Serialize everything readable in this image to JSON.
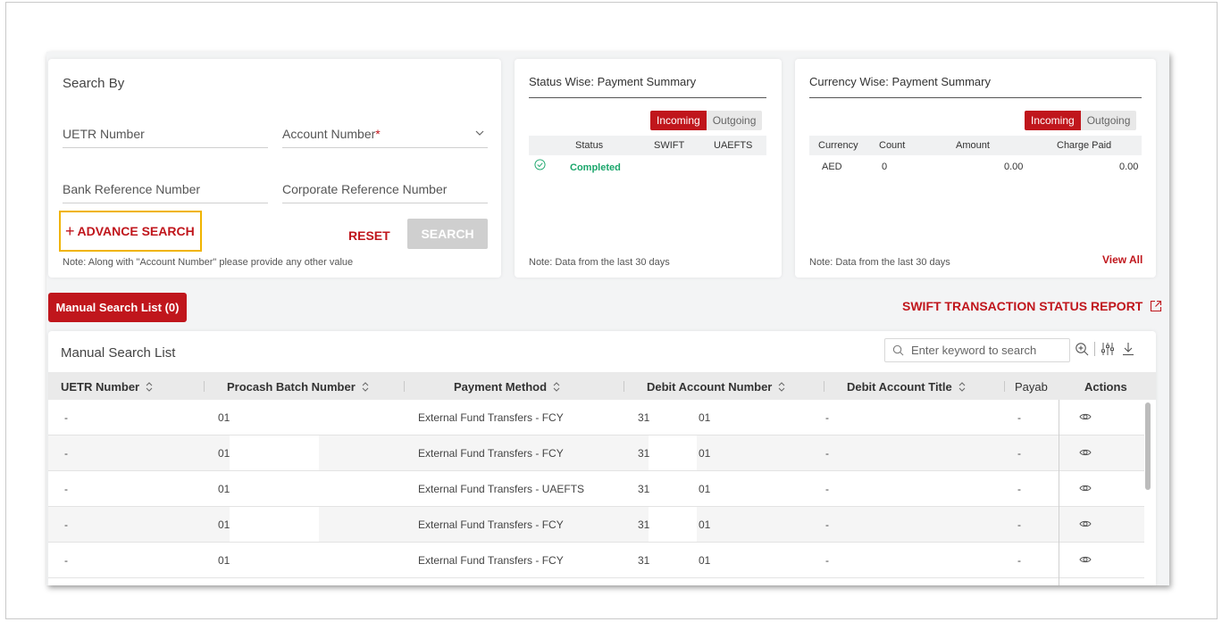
{
  "search": {
    "title": "Search By",
    "uetr_label": "UETR Number",
    "account_label": "Account Number",
    "account_required": "*",
    "bank_ref_label": "Bank Reference Number",
    "corp_ref_label": "Corporate Reference Number",
    "advance_plus": "+",
    "advance_label": "ADVANCE SEARCH",
    "reset_label": "RESET",
    "search_label": "SEARCH",
    "note": "Note: Along with \"Account Number\" please provide any other value"
  },
  "status_summary": {
    "title": "Status Wise: Payment Summary",
    "toggle_on": "Incoming",
    "toggle_off": "Outgoing",
    "headers": [
      "Status",
      "SWIFT",
      "UAEFTS"
    ],
    "row_status": "Completed",
    "note": "Note: Data from the last 30 days"
  },
  "currency_summary": {
    "title": "Currency Wise: Payment Summary",
    "toggle_on": "Incoming",
    "toggle_off": "Outgoing",
    "headers": [
      "Currency",
      "Count",
      "Amount",
      "Charge Paid"
    ],
    "row": [
      "AED",
      "0",
      "0.00",
      "0.00"
    ],
    "note": "Note: Data from the last 30 days",
    "view_all": "View All"
  },
  "tabs": {
    "manual_list": "Manual Search List (0)"
  },
  "report_link": "SWIFT TRANSACTION STATUS REPORT",
  "table": {
    "title": "Manual Search List",
    "search_placeholder": "Enter keyword to search",
    "columns": [
      "UETR Number",
      "Procash Batch Number",
      "Payment Method",
      "Debit Account Number",
      "Debit Account Title",
      "Payab",
      "Actions"
    ],
    "rows": [
      {
        "uetr": "-",
        "batch": "01",
        "method": "External Fund Transfers - FCY",
        "acct_a": "31",
        "acct_b": "01",
        "title": "-",
        "payab": "-"
      },
      {
        "uetr": "-",
        "batch": "01",
        "method": "External Fund Transfers - FCY",
        "acct_a": "31",
        "acct_b": "01",
        "title": "-",
        "payab": "-"
      },
      {
        "uetr": "-",
        "batch": "01",
        "method": "External Fund Transfers - UAEFTS",
        "acct_a": "31",
        "acct_b": "01",
        "title": "-",
        "payab": "-"
      },
      {
        "uetr": "-",
        "batch": "01",
        "method": "External Fund Transfers - FCY",
        "acct_a": "31",
        "acct_b": "01",
        "title": "-",
        "payab": "-"
      },
      {
        "uetr": "-",
        "batch": "01",
        "method": "External Fund Transfers - FCY",
        "acct_a": "31",
        "acct_b": "01",
        "title": "-",
        "payab": "-"
      }
    ]
  },
  "colors": {
    "brand_red": "#c0161c",
    "highlight_yellow": "#f0b400",
    "success_green": "#1aa66b"
  },
  "icons": [
    "chevron-down-icon",
    "check-circle-icon",
    "search-icon",
    "zoom-in-icon",
    "column-settings-icon",
    "download-icon",
    "external-link-icon",
    "sort-icon",
    "eye-icon"
  ]
}
